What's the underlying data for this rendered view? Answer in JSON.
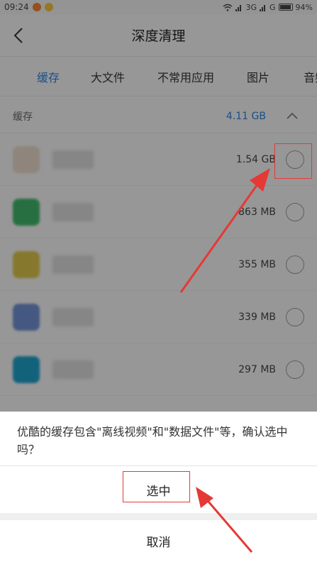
{
  "status_bar": {
    "time": "09:24",
    "network": "3G",
    "network2": "G",
    "battery": "94%"
  },
  "header": {
    "title": "深度清理",
    "back_icon": "chevron-left-icon"
  },
  "tabs": [
    {
      "label": "缓存",
      "active": true
    },
    {
      "label": "大文件",
      "active": false
    },
    {
      "label": "不常用应用",
      "active": false
    },
    {
      "label": "图片",
      "active": false
    },
    {
      "label": "音频",
      "active": false
    }
  ],
  "section": {
    "title": "缓存",
    "total_size": "4.11 GB"
  },
  "items": [
    {
      "size": "1.54 GB",
      "icon_color": "#e7d7c8"
    },
    {
      "size": "863 MB",
      "icon_color": "#3fb46a"
    },
    {
      "size": "355 MB",
      "icon_color": "#d9c24a"
    },
    {
      "size": "339 MB",
      "icon_color": "#6f8fd0"
    },
    {
      "size": "297 MB",
      "icon_color": "#1f9fc9"
    }
  ],
  "dialog": {
    "message": "优酷的缓存包含\"离线视频\"和\"数据文件\"等，确认选中吗？",
    "confirm_label": "选中",
    "cancel_label": "取消"
  },
  "colors": {
    "accent": "#2b7fd9",
    "annotation": "#e53935"
  }
}
